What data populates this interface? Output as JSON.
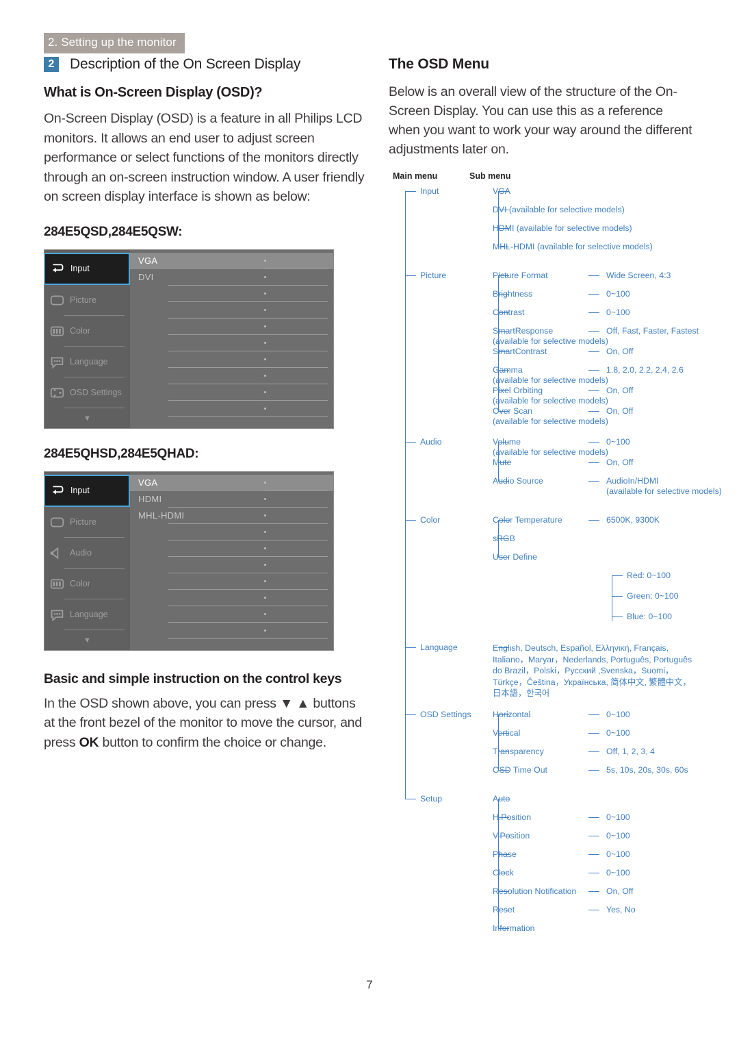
{
  "running_header": "2. Setting up the monitor",
  "page_number": "7",
  "colors": {
    "header_bar": "#a9a19c",
    "badge_blue": "#3c7ca8",
    "tree_blue": "#3f7fc1",
    "osd_bg": "#6e6e6e",
    "osd_sidebar": "#606060",
    "osd_active": "#1d1d1d",
    "osd_active_border": "#4aa8e0"
  },
  "left": {
    "section_number": "2",
    "section_title": "Description of the On Screen Display",
    "sub_heading": "What is On-Screen Display (OSD)?",
    "intro_paragraph": "On-Screen Display (OSD) is a feature in all Philips LCD monitors. It allows an end user to adjust screen performance or select functions of the monitors directly through an on-screen instruction window. A user friendly on screen display interface is shown as below:",
    "model_heading_1": "284E5QSD,284E5QSW:",
    "model_heading_2": "284E5QHSD,284E5QHAD:",
    "control_keys_heading": "Basic and simple instruction on the control keys",
    "control_keys_text_1": "In the OSD shown above, you can press ",
    "control_keys_arrows": "▼ ▲",
    "control_keys_text_2": " buttons at the front bezel of the monitor to move the cursor, and press ",
    "control_keys_ok": "OK",
    "control_keys_text_3": " button to confirm the choice or change."
  },
  "osd_panel_1": {
    "sidebar": [
      {
        "label": "Input",
        "icon": "input-arrow-icon",
        "active": true
      },
      {
        "label": "Picture",
        "icon": "picture-frame-icon",
        "active": false
      },
      {
        "label": "Color",
        "icon": "color-bars-icon",
        "active": false
      },
      {
        "label": "Language",
        "icon": "speech-bubble-icon",
        "active": false
      },
      {
        "label": "OSD Settings",
        "icon": "osd-settings-icon",
        "active": false
      }
    ],
    "scroll_chevron": "▼",
    "rows": [
      {
        "label": "VGA",
        "highlighted": true
      },
      {
        "label": "DVI",
        "highlighted": false
      },
      {
        "label": "",
        "highlighted": false
      },
      {
        "label": "",
        "highlighted": false
      },
      {
        "label": "",
        "highlighted": false
      },
      {
        "label": "",
        "highlighted": false
      },
      {
        "label": "",
        "highlighted": false
      },
      {
        "label": "",
        "highlighted": false
      },
      {
        "label": "",
        "highlighted": false
      },
      {
        "label": "",
        "highlighted": false
      }
    ]
  },
  "osd_panel_2": {
    "sidebar": [
      {
        "label": "Input",
        "icon": "input-arrow-icon",
        "active": true
      },
      {
        "label": "Picture",
        "icon": "picture-frame-icon",
        "active": false
      },
      {
        "label": "Audio",
        "icon": "speaker-icon",
        "active": false
      },
      {
        "label": "Color",
        "icon": "color-bars-icon",
        "active": false
      },
      {
        "label": "Language",
        "icon": "speech-bubble-icon",
        "active": false
      }
    ],
    "scroll_chevron": "▼",
    "rows": [
      {
        "label": "VGA",
        "highlighted": true
      },
      {
        "label": "HDMI",
        "highlighted": false
      },
      {
        "label": "MHL-HDMI",
        "highlighted": false
      },
      {
        "label": "",
        "highlighted": false
      },
      {
        "label": "",
        "highlighted": false
      },
      {
        "label": "",
        "highlighted": false
      },
      {
        "label": "",
        "highlighted": false
      },
      {
        "label": "",
        "highlighted": false
      },
      {
        "label": "",
        "highlighted": false
      },
      {
        "label": "",
        "highlighted": false
      }
    ]
  },
  "right": {
    "title": "The OSD Menu",
    "paragraph": "Below is an overall view of the structure of the On-Screen Display. You can use this as a reference when you want to work your way around the different adjustments later on.",
    "column_header_main": "Main menu",
    "column_header_sub": "Sub menu"
  },
  "menu_tree": [
    {
      "main": "Input",
      "items": [
        {
          "name": "VGA",
          "value": "",
          "note": ""
        },
        {
          "name": "DVI (available for selective models)",
          "value": "",
          "note": "",
          "wide": true
        },
        {
          "name": "HDMI (available for selective models)",
          "value": "",
          "note": "",
          "wide": true
        },
        {
          "name": "MHL-HDMI (available for selective models)",
          "value": "",
          "note": "",
          "wide": true
        }
      ]
    },
    {
      "main": "Picture",
      "items": [
        {
          "name": "Picture Format",
          "value": "Wide Screen, 4:3",
          "note": ""
        },
        {
          "name": "Brightness",
          "value": "0~100",
          "note": ""
        },
        {
          "name": "Contrast",
          "value": "0~100",
          "note": ""
        },
        {
          "name": "SmartResponse",
          "value": "Off, Fast, Faster, Fastest",
          "note": "(available for selective models)"
        },
        {
          "name": "SmartContrast",
          "value": "On, Off",
          "note": ""
        },
        {
          "name": "Gamma",
          "value": "1.8, 2.0, 2.2, 2.4, 2.6",
          "note": "(available for selective models)"
        },
        {
          "name": "Pixel Orbiting",
          "value": "On, Off",
          "note": "(available for selective models)"
        },
        {
          "name": "Over Scan",
          "value": "On, Off",
          "note": "(available for selective models)"
        }
      ]
    },
    {
      "main": "Audio",
      "items": [
        {
          "name": "Volume",
          "value": "0~100",
          "note": "(available for selective models)"
        },
        {
          "name": "Mute",
          "value": "On, Off",
          "note": ""
        },
        {
          "name": "Audio Source",
          "value": "AudioIn/HDMI",
          "note": "",
          "value_note": "(available for selective models)"
        }
      ]
    },
    {
      "main": "Color",
      "items": [
        {
          "name": "Color Temperature",
          "value": "6500K, 9300K",
          "note": ""
        },
        {
          "name": "sRGB",
          "value": "",
          "note": ""
        },
        {
          "name": "User Define",
          "value": "",
          "note": "",
          "children": [
            "Red: 0~100",
            "Green: 0~100",
            "Blue: 0~100"
          ]
        }
      ]
    },
    {
      "main": "Language",
      "language_list": "English, Deutsch, Español, Ελληνική, Français, Italiano，Maryar，Nederlands, Português, Português do Brazil，Polski，Русский ,Svenska，Suomi，Türkçe，Čeština，Українська, 简体中文, 繁體中文，日本語，한국어",
      "items": []
    },
    {
      "main": "OSD Settings",
      "items": [
        {
          "name": "Horizontal",
          "value": "0~100",
          "note": ""
        },
        {
          "name": "Vertical",
          "value": "0~100",
          "note": ""
        },
        {
          "name": "Transparency",
          "value": "Off, 1, 2, 3, 4",
          "note": ""
        },
        {
          "name": "OSD Time Out",
          "value": "5s, 10s, 20s, 30s, 60s",
          "note": ""
        }
      ]
    },
    {
      "main": "Setup",
      "items": [
        {
          "name": "Auto",
          "value": "",
          "note": ""
        },
        {
          "name": "H.Position",
          "value": "0~100",
          "note": ""
        },
        {
          "name": "V.Position",
          "value": "0~100",
          "note": ""
        },
        {
          "name": "Phase",
          "value": "0~100",
          "note": ""
        },
        {
          "name": "Clock",
          "value": "0~100",
          "note": ""
        },
        {
          "name": "Resolution Notification",
          "value": "On, Off",
          "note": ""
        },
        {
          "name": "Reset",
          "value": "Yes, No",
          "note": ""
        },
        {
          "name": "Information",
          "value": "",
          "note": ""
        }
      ]
    }
  ]
}
